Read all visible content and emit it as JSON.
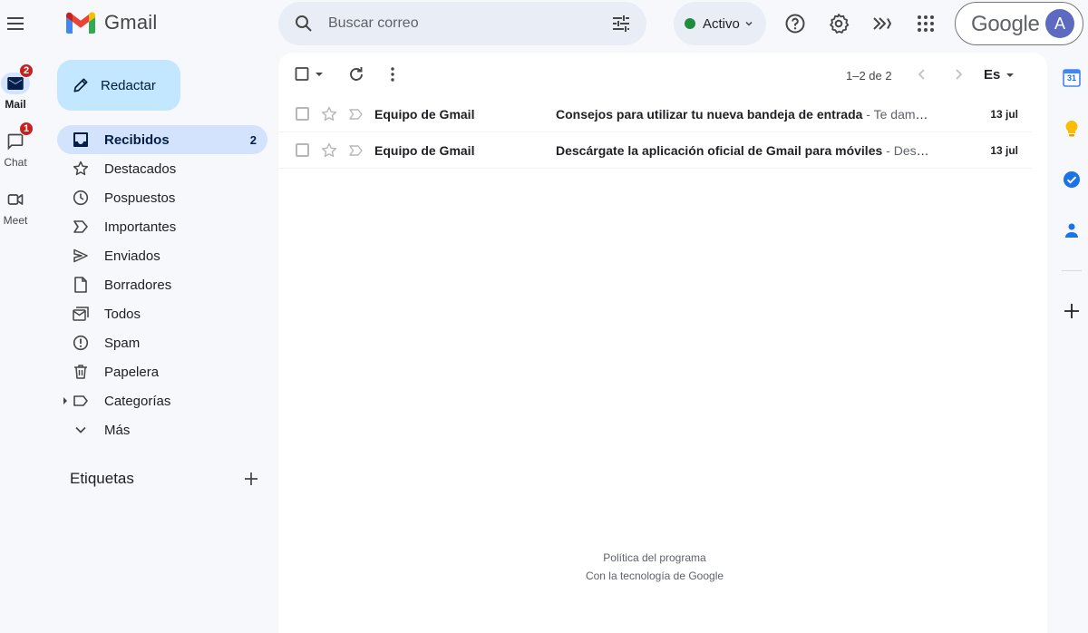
{
  "rail": {
    "apps": [
      {
        "label": "Mail",
        "badge": "2",
        "icon": "mail-icon",
        "active": true
      },
      {
        "label": "Chat",
        "badge": "1",
        "icon": "chat-icon",
        "active": false
      },
      {
        "label": "Meet",
        "badge": "",
        "icon": "meet-icon",
        "active": false
      }
    ]
  },
  "header": {
    "logo_text": "Gmail",
    "search_placeholder": "Buscar correo",
    "status_label": "Activo",
    "account_brand": "Google",
    "avatar_letter": "A"
  },
  "compose": {
    "label": "Redactar"
  },
  "nav": {
    "items": [
      {
        "label": "Recibidos",
        "count": "2",
        "icon": "inbox-icon"
      },
      {
        "label": "Destacados",
        "count": "",
        "icon": "star-icon"
      },
      {
        "label": "Pospuestos",
        "count": "",
        "icon": "clock-icon"
      },
      {
        "label": "Importantes",
        "count": "",
        "icon": "important-icon"
      },
      {
        "label": "Enviados",
        "count": "",
        "icon": "send-icon"
      },
      {
        "label": "Borradores",
        "count": "",
        "icon": "draft-icon"
      },
      {
        "label": "Todos",
        "count": "",
        "icon": "all-mail-icon"
      },
      {
        "label": "Spam",
        "count": "",
        "icon": "spam-icon"
      },
      {
        "label": "Papelera",
        "count": "",
        "icon": "trash-icon"
      },
      {
        "label": "Categorías",
        "count": "",
        "icon": "label-icon"
      },
      {
        "label": "Más",
        "count": "",
        "icon": "chevron-down-icon"
      }
    ],
    "labels_heading": "Etiquetas"
  },
  "toolbar": {
    "pager": "1–2 de 2",
    "lang": "Es"
  },
  "emails": [
    {
      "sender": "Equipo de Gmail",
      "subject": "Consejos para utilizar tu nueva bandeja de entrada",
      "separator": " - ",
      "snippet": "Te damos la bienvenida a tu bandeja de entrada",
      "date": "13 jul"
    },
    {
      "sender": "Equipo de Gmail",
      "subject": "Descárgate la aplicación oficial de Gmail para móviles",
      "separator": " - ",
      "snippet": "Descarga la aplicación oficial de Gmail",
      "date": "13 jul"
    }
  ],
  "footer": {
    "policy": "Política del programa",
    "powered": "Con la tecnología de Google"
  },
  "side_panel": {
    "calendar_day": "31"
  },
  "colors": {
    "background": "#f6f8fc",
    "compose": "#c2e7ff",
    "active_nav": "#d3e3fd",
    "badge": "#c5221f",
    "status_dot": "#1e8e3e"
  }
}
